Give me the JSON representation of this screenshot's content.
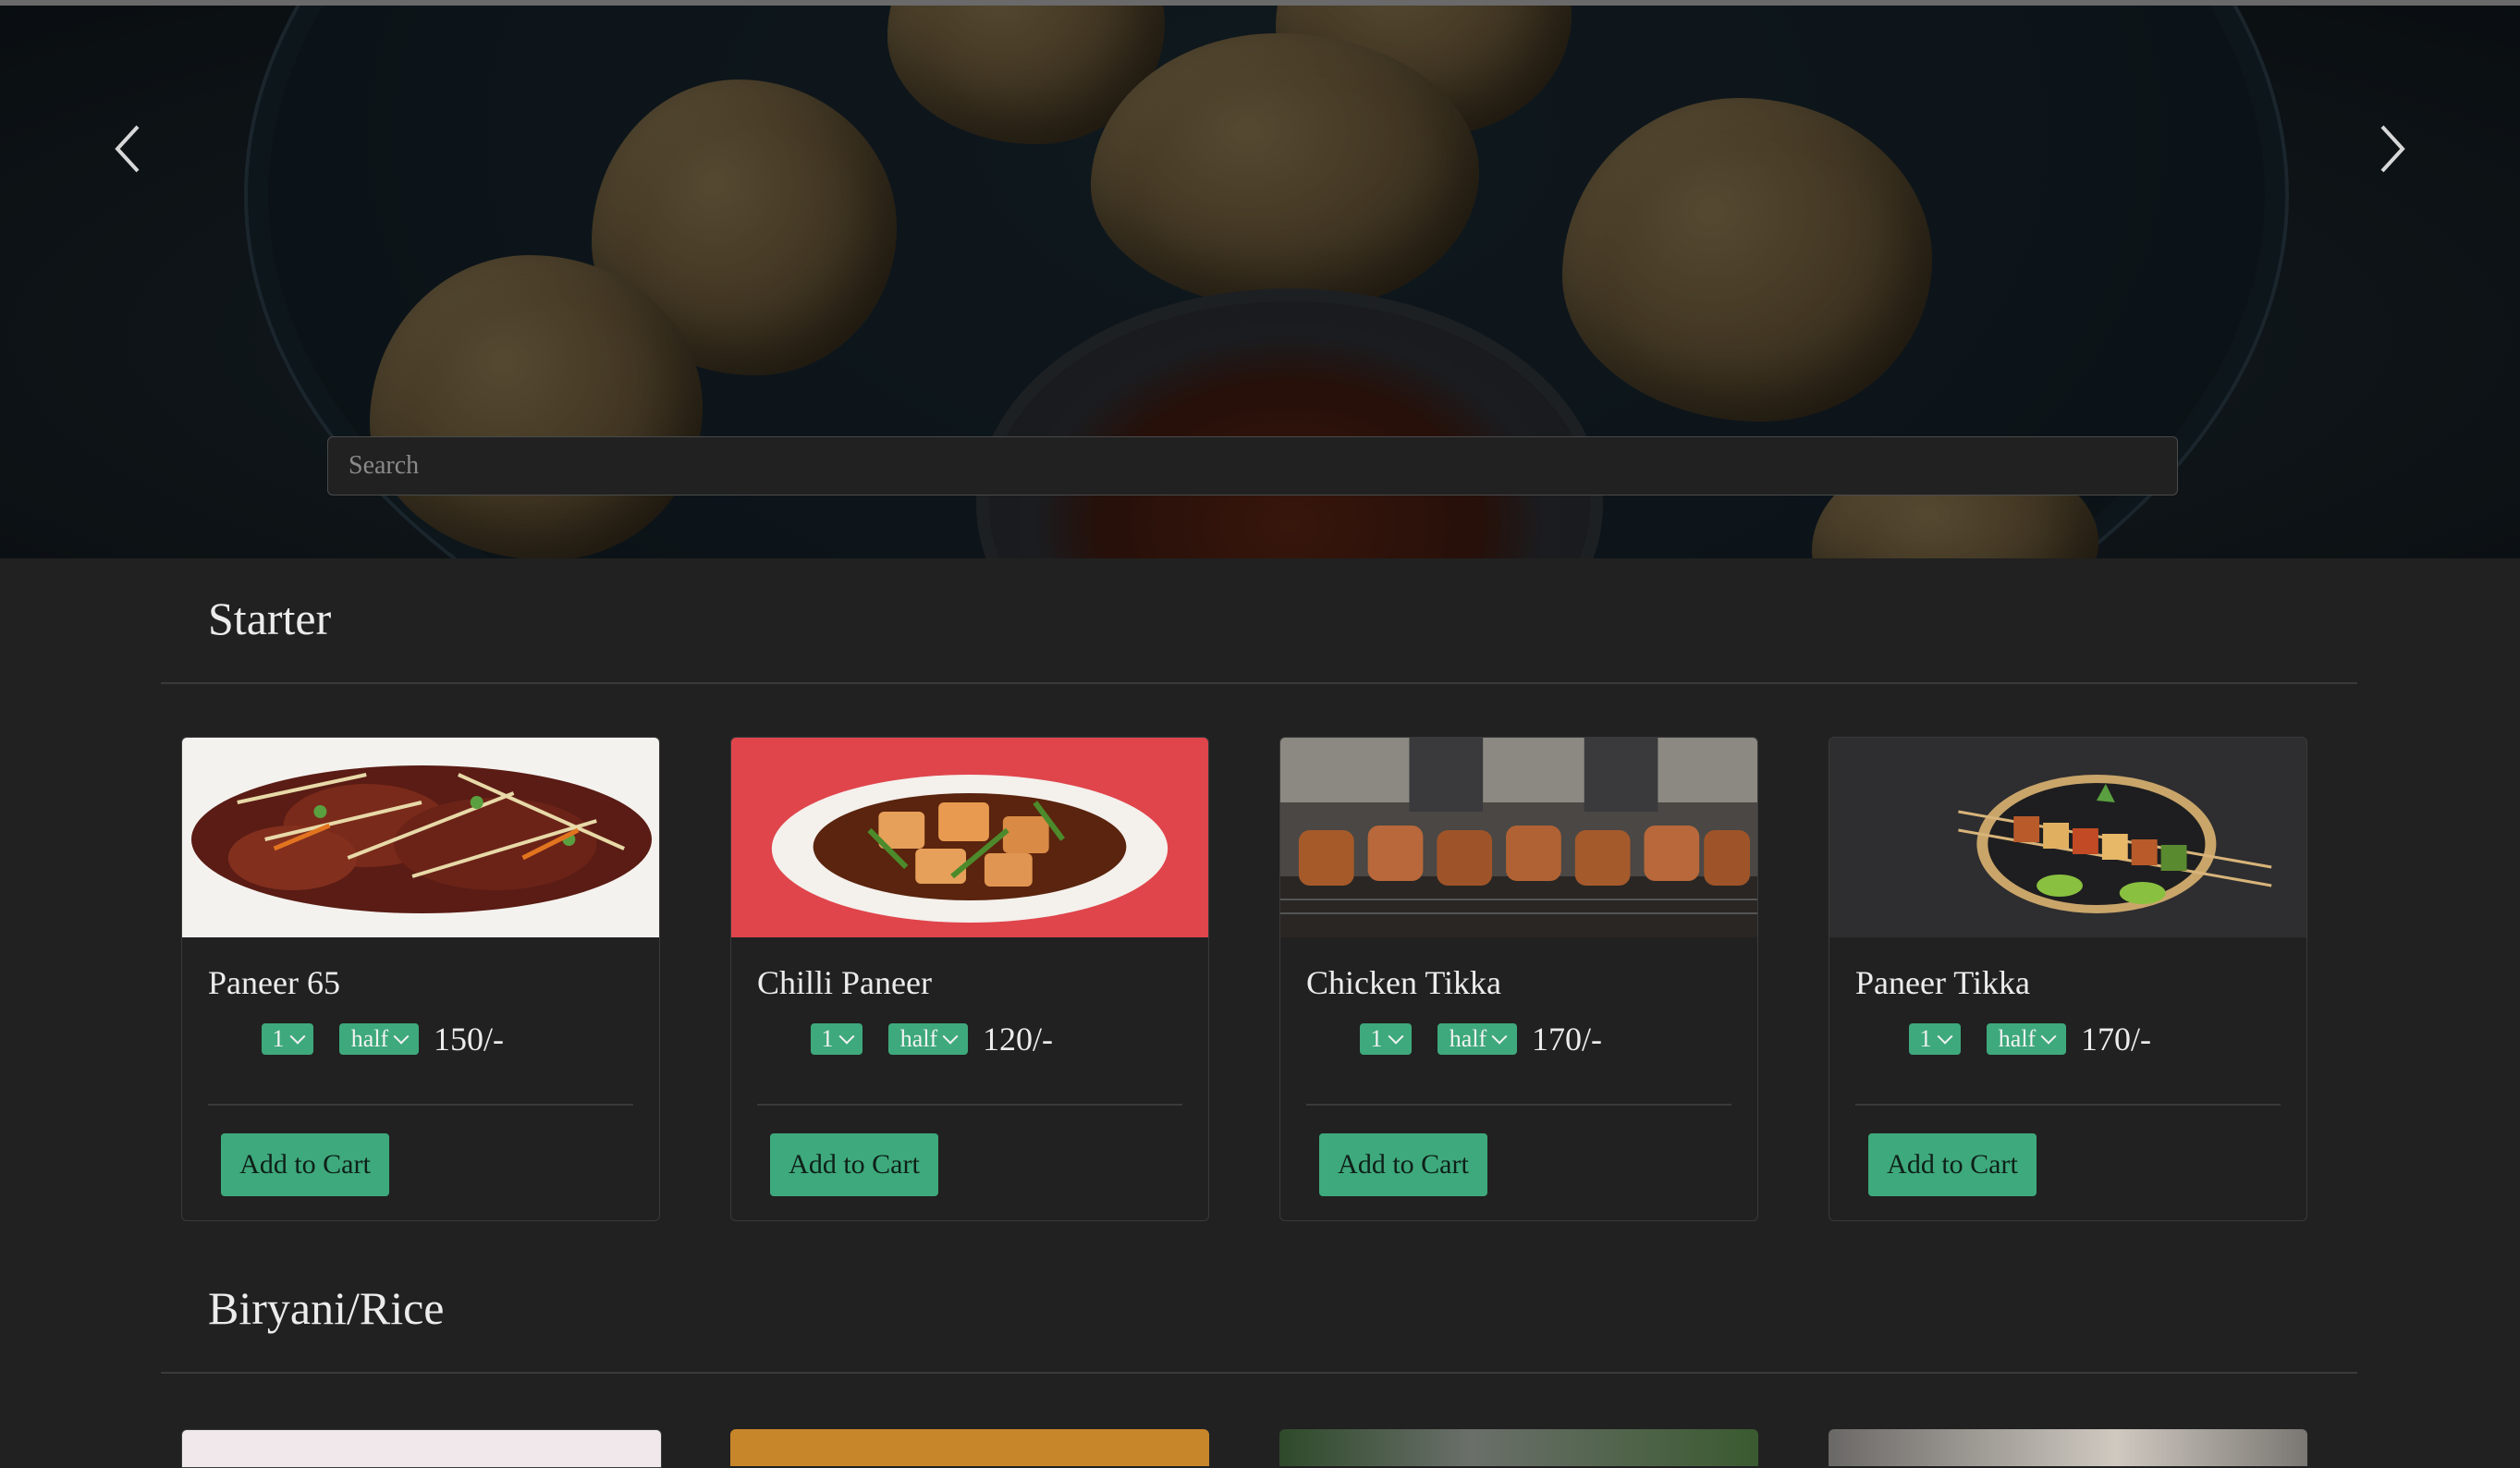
{
  "search": {
    "placeholder": "Search"
  },
  "sections": [
    {
      "title": "Starter",
      "items": [
        {
          "name": "Paneer 65",
          "qty": "1",
          "size": "half",
          "price": "150/-",
          "button": "Add to Cart"
        },
        {
          "name": "Chilli Paneer",
          "qty": "1",
          "size": "half",
          "price": "120/-",
          "button": "Add to Cart"
        },
        {
          "name": "Chicken Tikka",
          "qty": "1",
          "size": "half",
          "price": "170/-",
          "button": "Add to Cart"
        },
        {
          "name": "Paneer Tikka",
          "qty": "1",
          "size": "half",
          "price": "170/-",
          "button": "Add to Cart"
        }
      ]
    },
    {
      "title": "Biryani/Rice",
      "items": []
    }
  ],
  "colors": {
    "accent": "#3ea97c",
    "background": "#212121",
    "border": "#3a3a3a"
  },
  "icons": {
    "prev": "chevron-left-icon",
    "next": "chevron-right-icon",
    "dropdown": "chevron-down-icon"
  }
}
